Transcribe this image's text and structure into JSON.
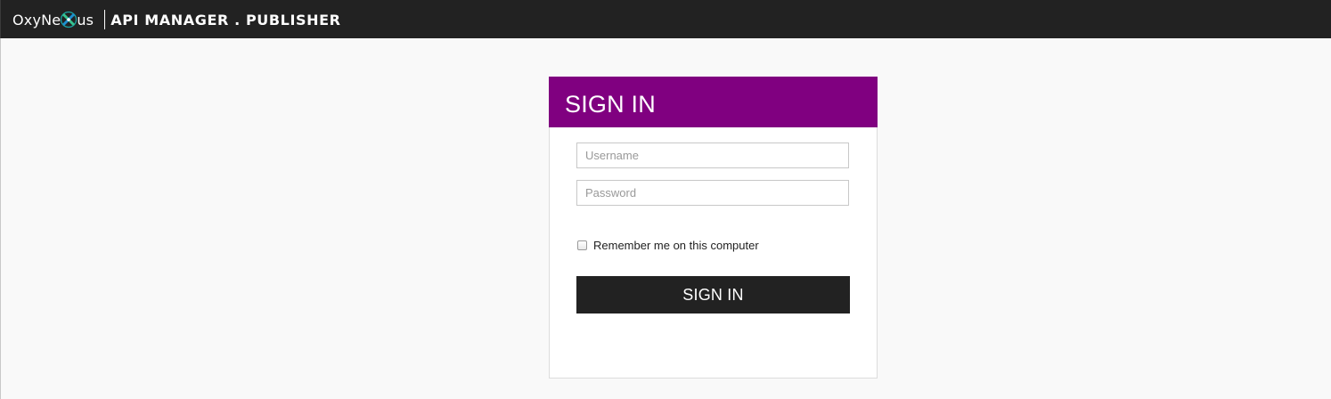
{
  "header": {
    "brand_left": "OxyNe",
    "brand_right": "us",
    "product_title": "API MANAGER . PUBLISHER",
    "background": "#222222"
  },
  "login": {
    "title": "SIGN IN",
    "header_color": "#800080",
    "username": {
      "value": "",
      "placeholder": "Username"
    },
    "password": {
      "value": "",
      "placeholder": "Password"
    },
    "remember_label": "Remember me on this computer",
    "remember_checked": false,
    "submit_label": "SIGN IN"
  },
  "icons": {
    "brand_logo": "oxynexus-x-logo-icon"
  }
}
